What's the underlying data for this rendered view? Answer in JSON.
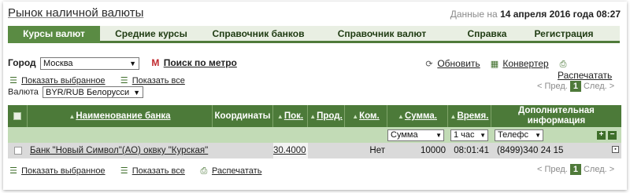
{
  "header": {
    "title": "Рынок наличной валюты",
    "date_prefix": "Данные на",
    "date_value": "14 апреля 2016 года 08:27"
  },
  "tabs": [
    {
      "label": "Курсы валют",
      "active": true
    },
    {
      "label": "Средние курсы",
      "active": false
    },
    {
      "label": "Справочник банков",
      "active": false
    },
    {
      "label": "Справочник валют",
      "active": false
    },
    {
      "label": "Справка",
      "active": false
    },
    {
      "label": "Регистрация",
      "active": false
    }
  ],
  "filters": {
    "city_label": "Город",
    "city_value": "Москва",
    "metro_search": "Поиск по метро",
    "metro_icon_glyph": "М",
    "show_selected": "Показать выбранное",
    "show_all": "Показать все",
    "currency_label": "Валюта",
    "currency_value": "BYR/RUB  Белорусси"
  },
  "actions": {
    "refresh": "Обновить",
    "converter": "Конвертер",
    "print": "Распечатать"
  },
  "pager": {
    "prev": "< Пред.",
    "current": "1",
    "next": "След. >"
  },
  "table": {
    "columns": {
      "bank_name": "Наименование банка",
      "coordinates": "Координаты",
      "buy": "Пок.",
      "sell": "Прод.",
      "commission": "Ком.",
      "amount": "Сумма.",
      "time": "Время.",
      "extra_line1": "Дополнительная",
      "extra_line2": "информация"
    },
    "filter_row": {
      "amount_select": "Сумма",
      "time_select": "1 час",
      "extra_select": "Телефс"
    },
    "rows": [
      {
        "bank": "Банк \"Новый Символ\"(АО) оквку \"Курская\"",
        "coordinates": "",
        "buy": "30.4000",
        "sell": "",
        "commission": "Нет",
        "amount": "10000",
        "time": "08:01:41",
        "phone": "(8499)340 24 15"
      }
    ]
  },
  "footer": {
    "show_selected": "Показать выбранное",
    "show_all": "Показать все",
    "print": "Распечатать"
  },
  "colors": {
    "accent": "#4c7a39",
    "tab_bar": "#e9efe3",
    "filter_row": "#c2dbb6",
    "data_row": "#dadada"
  }
}
